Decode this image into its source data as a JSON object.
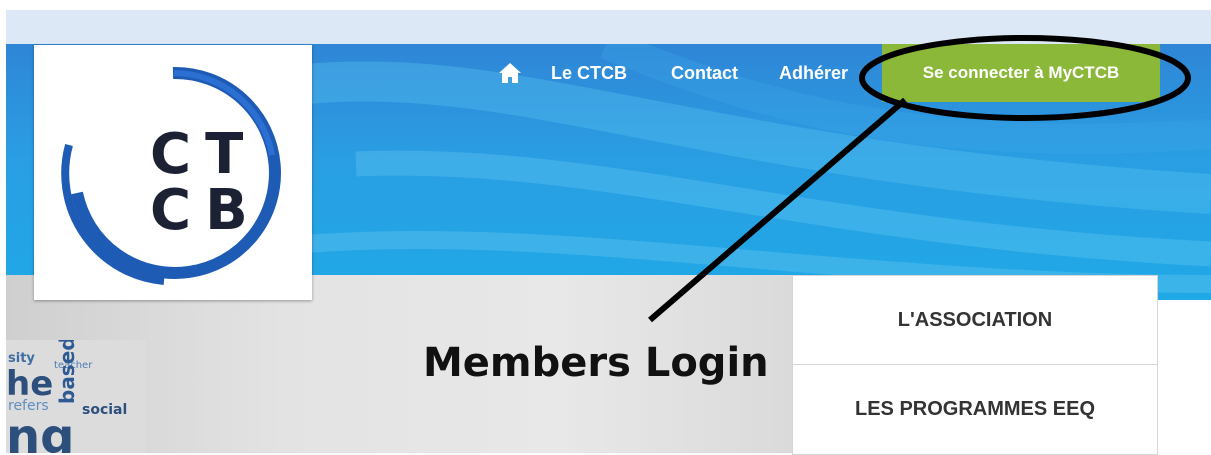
{
  "nav": {
    "home_icon": "home-icon",
    "items": [
      "Le CTCB",
      "Contact",
      "Adhérer"
    ],
    "login_button": "Se connecter à MyCTCB"
  },
  "logo": {
    "line1": "CT",
    "line2": "CB"
  },
  "side_menu": {
    "items": [
      "L'ASSOCIATION",
      "LES PROGRAMMES EEQ"
    ]
  },
  "annotation": {
    "text": "Members Login"
  },
  "collage": {
    "words": [
      "sity",
      "he",
      "teacher",
      "based",
      "refers",
      "social",
      "ng"
    ]
  },
  "colors": {
    "banner": "#2a9ee3",
    "login_button": "#8cb83a",
    "logo_ring": "#1e5bb5",
    "logo_text": "#1c2233"
  }
}
